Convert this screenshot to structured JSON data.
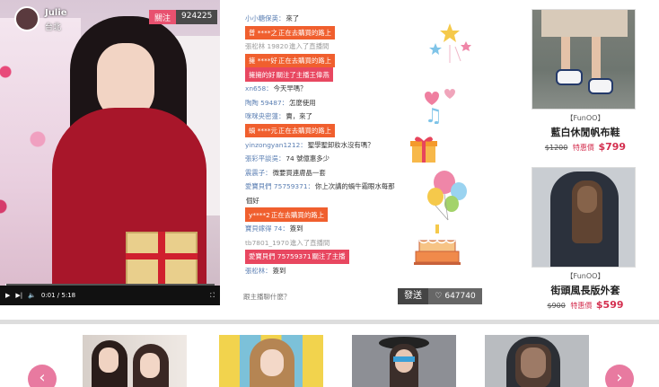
{
  "host": {
    "name": "Julie",
    "location": "台北",
    "follow_label": "關注",
    "follower_count": "924225"
  },
  "player": {
    "time": "0:01 / 5:18",
    "progress": 0.003
  },
  "chat": [
    {
      "user": "小小糖保英：",
      "text": "來了",
      "style": "normal"
    },
    {
      "user": "普 ****之",
      "text": " 正在去購買的路上",
      "style": "orange"
    },
    {
      "user": "張松林 19820",
      "text": " 進入了直播間",
      "style": "gray"
    },
    {
      "user": "擁 ****好",
      "text": " 正在去購買的路上",
      "style": "orange"
    },
    {
      "user": "擁擁的好",
      "text": " 關注了主播王偉燕",
      "style": "red"
    },
    {
      "user": "xn658：",
      "text": "今天早嗎？",
      "style": "normal"
    },
    {
      "user": "陶陶 59487：",
      "text": "怎麼使用",
      "style": "normal"
    },
    {
      "user": "咪咪央密蓮：",
      "text": "賣，來了",
      "style": "normal"
    },
    {
      "user": "蝸 ****元",
      "text": " 正在去購買的路上",
      "style": "orange"
    },
    {
      "user": "yinzongyan1212：",
      "text": "聖學聖卸妝水沒有嗎？",
      "style": "normal"
    },
    {
      "user": "張彩平談吳：",
      "text": "74 號億惠多少",
      "style": "normal"
    },
    {
      "user": "震震子：",
      "text": "微要買連膚晶一套",
      "style": "normal"
    },
    {
      "user": "愛寶貝們 75759371：",
      "text": "你上次講的蝸牛霜眼水每那",
      "style": "normal"
    },
    {
      "user": "",
      "text": "個好",
      "style": "normal"
    },
    {
      "user": "y****2",
      "text": " 正在去購買的路上",
      "style": "orange"
    },
    {
      "user": "寶貝嫁得 74：",
      "text": "簽到",
      "style": "normal"
    },
    {
      "user": "tb7801_1970",
      "text": " 進入了直播間",
      "style": "gray"
    },
    {
      "user": "愛寶貝們 75759371",
      "text": " 關注了主播",
      "style": "red"
    },
    {
      "user": "張松林：",
      "text": "簽到",
      "style": "normal"
    }
  ],
  "chat_input": {
    "placeholder": "跟主播聊什麼？",
    "send_label": "發送",
    "like_count": "647740"
  },
  "products": [
    {
      "shop": "【FunOO】",
      "name": "藍白休閒帆布鞋",
      "old_price": "$1200",
      "sale_label": "特惠價",
      "price": "$799"
    },
    {
      "shop": "【FunOO】",
      "name": "街頭風長版外套",
      "old_price": "$900",
      "sale_label": "特惠價",
      "price": "$599"
    }
  ],
  "nav": {
    "prev": "‹",
    "next": "›"
  },
  "colors": {
    "accent": "#e8516f",
    "sale": "#d42f4f",
    "order": "#f05f2e"
  }
}
